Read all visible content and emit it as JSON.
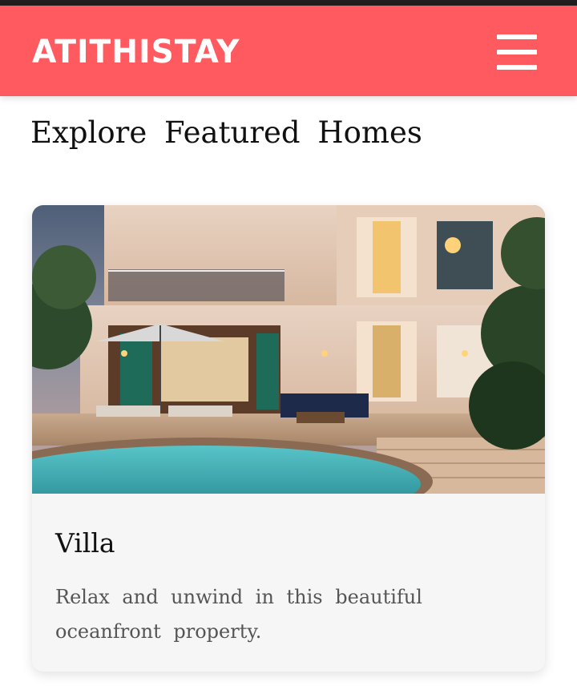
{
  "header": {
    "brand": "ATITHISTAY",
    "menu_icon": "hamburger-menu-icon",
    "bg_color": "#ff5a5f"
  },
  "page": {
    "section_title": "Explore Featured Homes"
  },
  "cards": [
    {
      "title": "Villa",
      "description": "Relax and unwind in this beautiful oceanfront property.",
      "image": "villa-pool-photo"
    }
  ]
}
